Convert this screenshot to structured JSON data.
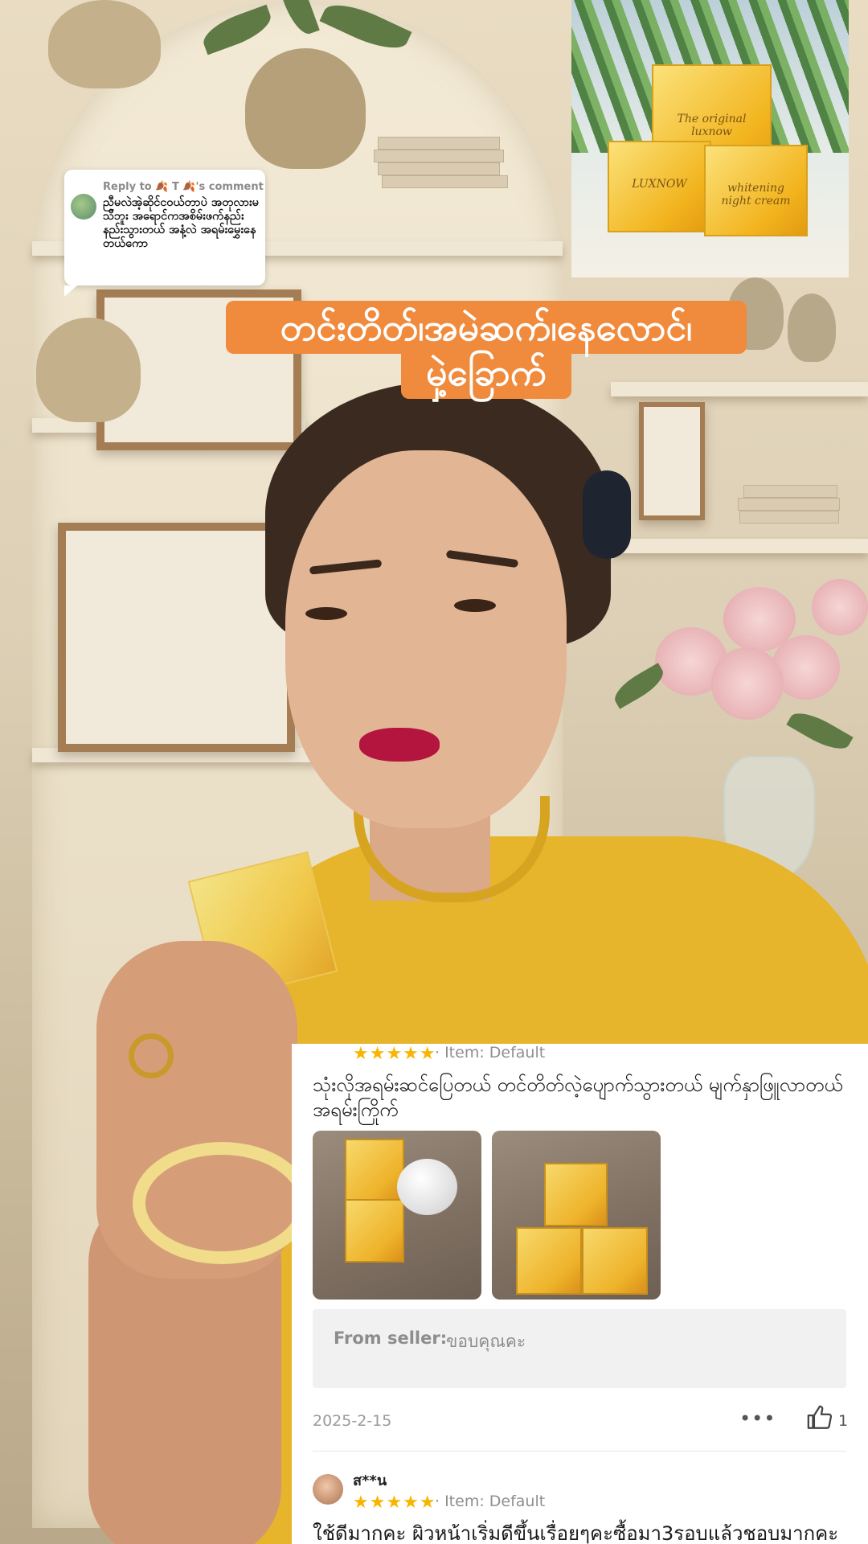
{
  "reply_bubble": {
    "header": "Reply to 🍂 T 🍂's comment",
    "message": "ညီမလဲအဲ့ဆိုင်ငဝယ်တာပဲ အတုလားမသိဘူး အရောင်ကအစိမ်းဖက်နည်းနည်းသွားတယ် အနံ့လဲ အရမ်းမွှေးနေတယ်ကော"
  },
  "product_photo": {
    "box_label_1": "The original luxnow",
    "box_label_2": "LUXNOW",
    "box_label_3": "whitening night cream"
  },
  "caption": {
    "line1": "တင်းတိတ်၊အမဲဆက်၊နေလောင်၊",
    "line2": "မှဲ့ခြောက်"
  },
  "review_panel": {
    "review1": {
      "stars": "★★★★★",
      "item": "· Item: Default",
      "text": "သုံးလိုအရမ်းဆင်ပြေတယ် တင်တိတ်လဲ့ပျောက်သွားတယ် မျက်နှာဖြူလာတယ် အရမ်းကြိုက်",
      "seller_label": "From seller:",
      "seller_reply": "ขอบคุณคะ",
      "date": "2025-2-15",
      "more": "•••",
      "likes": "1"
    },
    "review2": {
      "username": "ส**น",
      "stars": "★★★★★",
      "item": "· Item: Default",
      "text": "ใช้ดีมากคะ ผิวหน้าเริ่มดีขึ้นเรื่อยๆคะซื้อมา3รอบแล้วชอบมากคะ"
    }
  },
  "colors": {
    "caption_bg": "#f08a3c",
    "star": "#f7b500",
    "shirt": "#e6b52b"
  }
}
